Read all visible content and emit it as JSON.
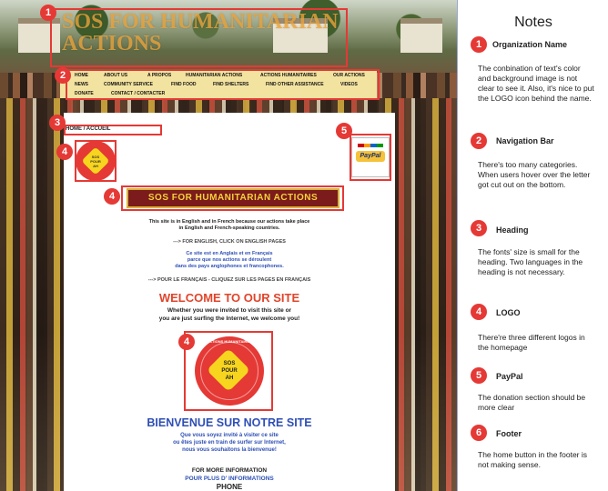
{
  "site": {
    "org_title": "SOS FOR HUMANITARIAN ACTIONS",
    "nav": {
      "row1": [
        "HOME",
        "ABOUT US",
        "A PROPOS",
        "HUMANITARIAN ACTIONS",
        "ACTIONS HUMANITAIRES",
        "OUR ACTIONS"
      ],
      "row2": [
        "NEWS",
        "COMMUNITY SERVICE",
        "FIND FOOD",
        "FIND SHELTERS",
        "FIND OTHER ASSISTANCE",
        "VIDEOS"
      ],
      "row3": [
        "DONATE",
        "CONTACT / CONTACTER"
      ]
    },
    "breadcrumb": "HOME / ACCUEIL",
    "small_logo_text": "SOS\nPOUR\nAH",
    "paypal_label": "PayPal",
    "banner": "SOS FOR HUMANITARIAN ACTIONS",
    "intro_line1": "This site is in English and in French because our actions take place",
    "intro_line2": "in English and French-speaking countries.",
    "english_link": "---> FOR ENGLISH, CLICK ON ENGLISH PAGES",
    "french_line1": "Ce site est en Anglais et en Français",
    "french_line2": "parce que nos actions se déroulent",
    "french_line3": "dans des pays anglophones et francophones.",
    "french_link": "---> POUR LE FRANÇAIS - CLIQUEZ SUR LES PAGES EN FRANÇAIS",
    "welcome": "WELCOME TO OUR SITE",
    "welcome_sub1": "Whether you were invited to visit this site or",
    "welcome_sub2": "you are just surfing the Internet, we welcome you!",
    "big_logo_arc": "ACTIONS HUMANITAIRES",
    "big_logo_text1": "SOS",
    "big_logo_text2": "POUR",
    "big_logo_text3": "AH",
    "bienvenue": "BIENVENUE SUR NOTRE SITE",
    "bienvenue_sub1": "Que vous soyez invité à visiter ce site",
    "bienvenue_sub2": "ou êtes juste en train de surfer sur Internet,",
    "bienvenue_sub3": "nous vous souhaitons la bienvenue!",
    "more_info": "FOR MORE INFORMATION",
    "plus_info": "POUR PLUS D' INFORMATIONS",
    "phone": "PHONE"
  },
  "annotations": {
    "badges": [
      "1",
      "2",
      "3",
      "4",
      "5",
      "4",
      "4"
    ]
  },
  "notes": {
    "title": "Notes",
    "items": [
      {
        "num": "1",
        "head": "Organization Name",
        "body": "The conbination of text's color and background image is not clear to see it. Also, it's nice to put the LOGO icon behind the name."
      },
      {
        "num": "2",
        "head": "Navigation Bar",
        "body": "There's too many categories. When users hover over the letter got cut out on the bottom."
      },
      {
        "num": "3",
        "head": "Heading",
        "body": "The fonts' size is small for the heading. Two languages in the heading is not necessary."
      },
      {
        "num": "4",
        "head": "LOGO",
        "body": "There're three different logos in the homepage"
      },
      {
        "num": "5",
        "head": "PayPal",
        "body": "The donation section should be more clear"
      },
      {
        "num": "6",
        "head": "Footer",
        "body": "The home button in the footer is not making sense."
      }
    ]
  },
  "colors": {
    "annotation_red": "#e53935",
    "title_orange": "#e8a23a",
    "nav_bg": "#f3e3a0",
    "welcome_red": "#e0452b",
    "bienvenue_blue": "#2e4fb5"
  }
}
